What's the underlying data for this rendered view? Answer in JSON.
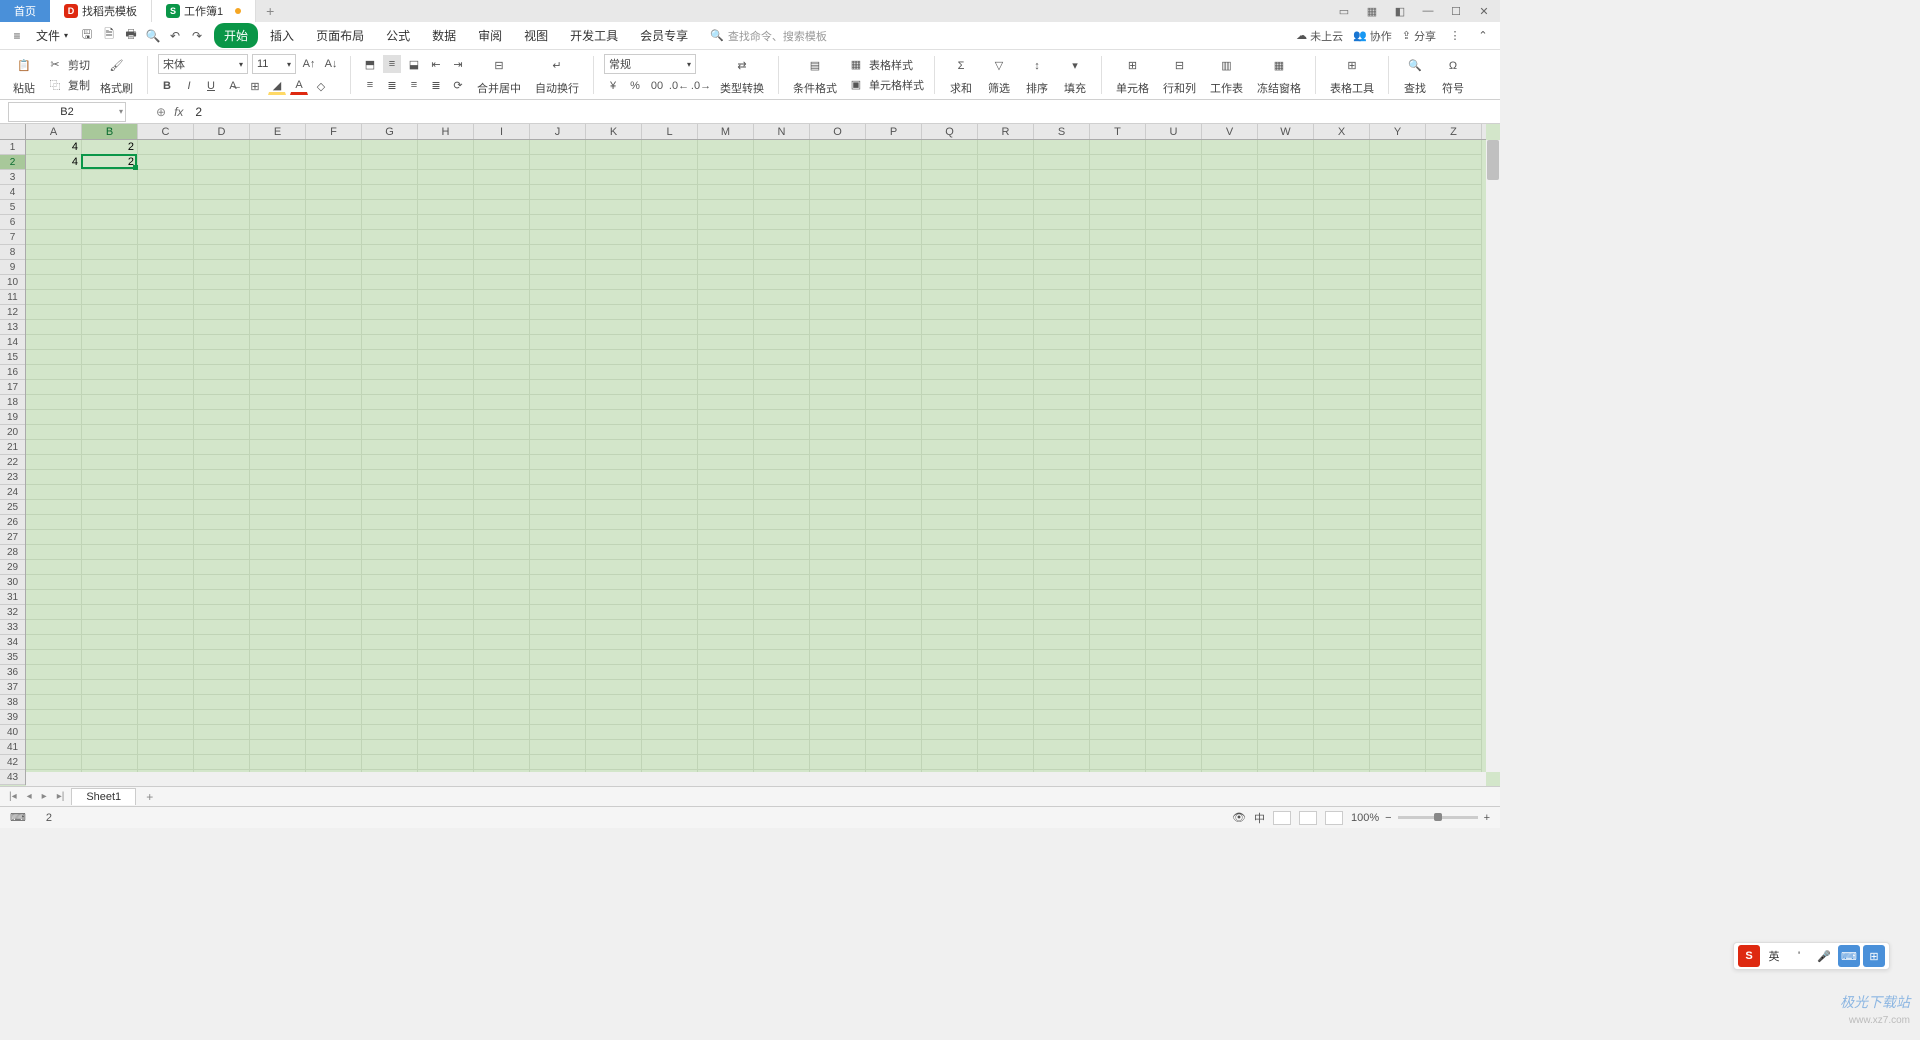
{
  "tabs": {
    "home": "首页",
    "template": "找稻壳模板",
    "doc": "工作簿1"
  },
  "menubar": {
    "file": "文件",
    "tabs": [
      "开始",
      "插入",
      "页面布局",
      "公式",
      "数据",
      "审阅",
      "视图",
      "开发工具",
      "会员专享"
    ],
    "search_placeholder": "查找命令、搜索模板",
    "cloud": "未上云",
    "collab": "协作",
    "share": "分享"
  },
  "ribbon": {
    "paste": "粘贴",
    "cut": "剪切",
    "copy": "复制",
    "painter": "格式刷",
    "font_name": "宋体",
    "font_size": "11",
    "merge": "合并居中",
    "wrap": "自动换行",
    "number_format": "常规",
    "type_convert": "类型转换",
    "cond_fmt": "条件格式",
    "table_style": "表格样式",
    "cell_style": "单元格样式",
    "sum": "求和",
    "filter": "筛选",
    "sort": "排序",
    "fill": "填充",
    "cell": "单元格",
    "rowcol": "行和列",
    "sheet": "工作表",
    "freeze": "冻结窗格",
    "tools": "表格工具",
    "find": "查找",
    "symbol": "符号"
  },
  "namebox": "B2",
  "formula": "2",
  "columns": [
    "A",
    "B",
    "C",
    "D",
    "E",
    "F",
    "G",
    "H",
    "I",
    "J",
    "K",
    "L",
    "M",
    "N",
    "O",
    "P",
    "Q",
    "R",
    "S",
    "T",
    "U",
    "V",
    "W",
    "X",
    "Y",
    "Z"
  ],
  "row_count": 43,
  "cells": {
    "A1": "4",
    "B1": "2",
    "A2": "4",
    "B2": "2"
  },
  "selected": {
    "col": 1,
    "row": 1
  },
  "sheet_tab": "Sheet1",
  "status_value": "2",
  "zoom": "100%",
  "ime": "英",
  "watermark1": "极光下载站",
  "watermark2": "www.xz7.com"
}
